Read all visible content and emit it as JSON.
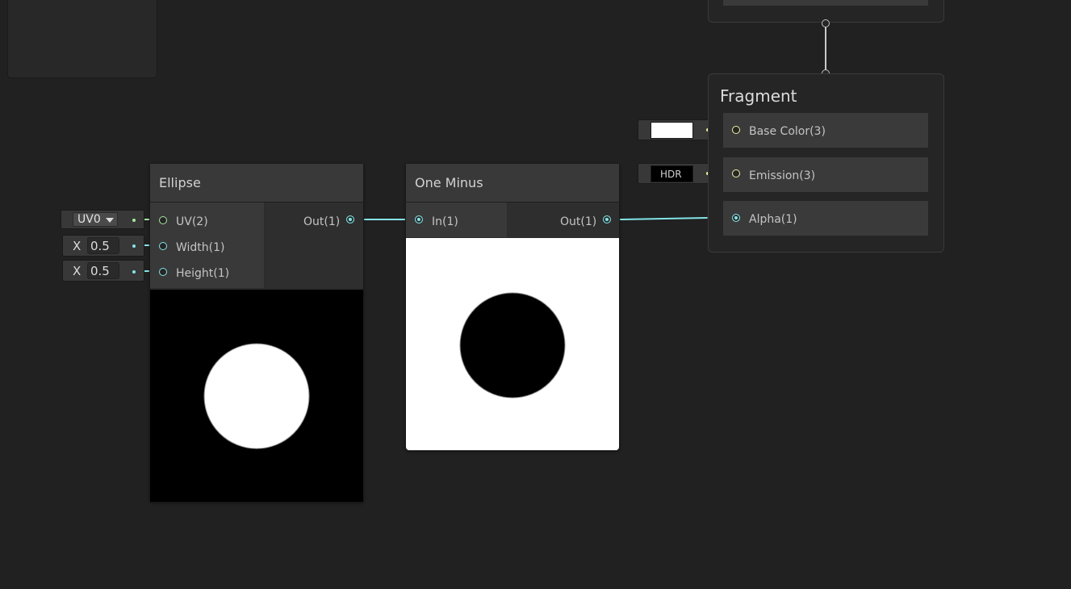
{
  "nodes": {
    "ellipse": {
      "title": "Ellipse",
      "inputs": [
        "UV(2)",
        "Width(1)",
        "Height(1)"
      ],
      "output": "Out(1)",
      "uv_dropdown": "UV0",
      "width": {
        "axis": "X",
        "value": "0.5"
      },
      "height": {
        "axis": "X",
        "value": "0.5"
      },
      "preview": {
        "background": "#000000",
        "shape": "#ffffff"
      }
    },
    "one_minus": {
      "title": "One Minus",
      "input": "In(1)",
      "output": "Out(1)",
      "preview": {
        "background": "#ffffff",
        "shape": "#000000"
      }
    },
    "fragment": {
      "title": "Fragment",
      "slots": [
        {
          "label": "Base Color(3)",
          "field": "color-swatch",
          "swatch": "#ffffff"
        },
        {
          "label": "Emission(3)",
          "field": "HDR"
        },
        {
          "label": "Alpha(1)"
        }
      ]
    }
  },
  "colors": {
    "background": "#212121",
    "float_wire": "#84e4e7",
    "vector2_wire": "#a6e6a0",
    "vector3_wire": "#f3f1a4"
  },
  "icons": {
    "dropdown": "triangle-down-icon"
  }
}
